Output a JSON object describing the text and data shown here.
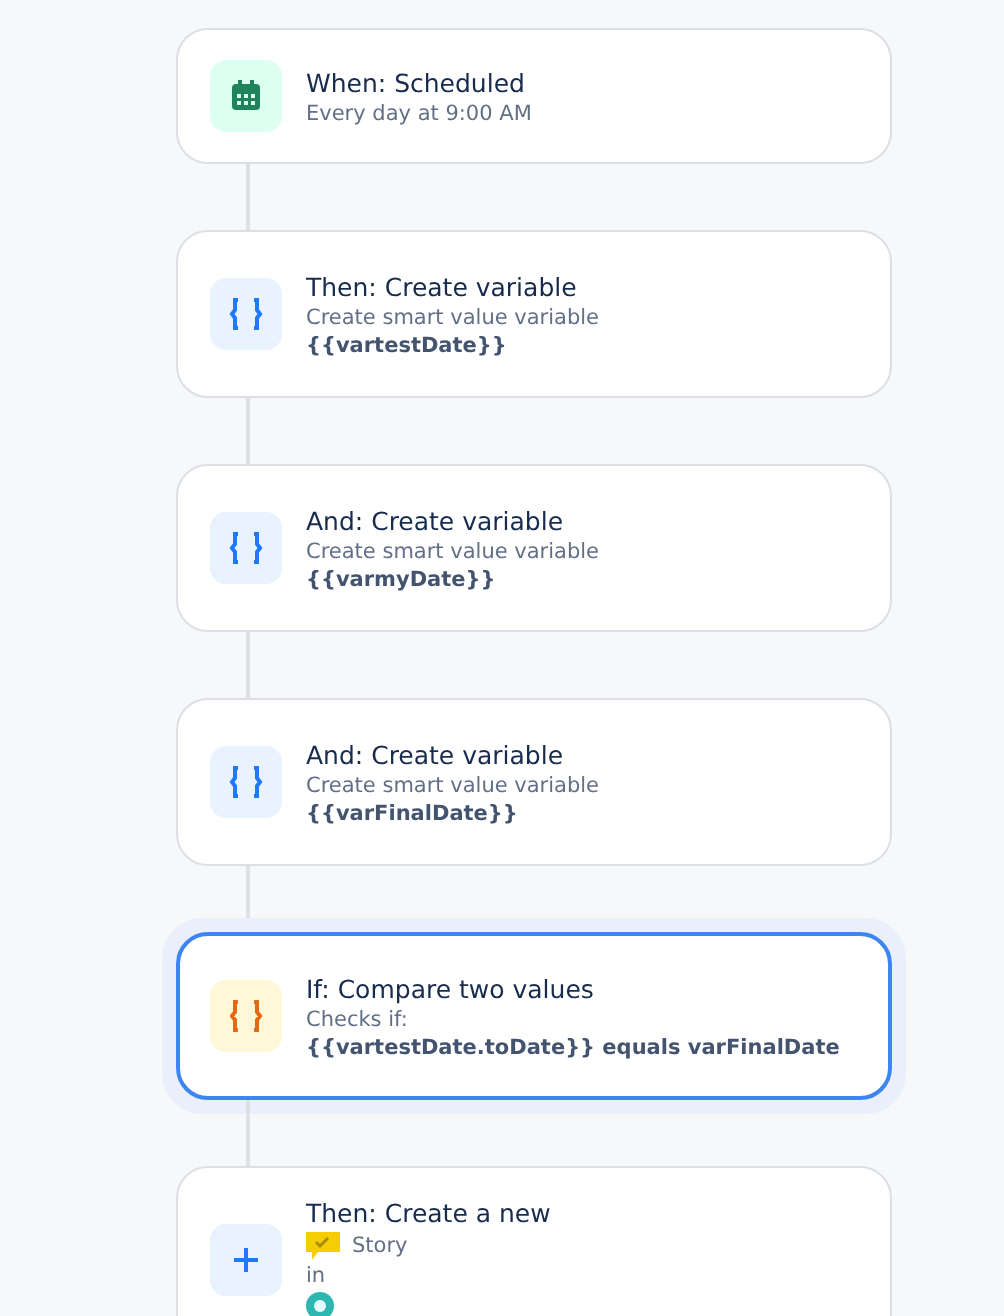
{
  "steps": [
    {
      "kind": "schedule",
      "title": "When: Scheduled",
      "selected": false,
      "lines": [
        {
          "kind": "plain",
          "text": "Every day at 9:00 AM"
        }
      ]
    },
    {
      "kind": "variable",
      "title": "Then: Create variable",
      "selected": false,
      "lines": [
        {
          "kind": "plain",
          "text": "Create smart value variable"
        },
        {
          "kind": "bold",
          "text": "{{vartestDate}}"
        }
      ]
    },
    {
      "kind": "variable",
      "title": "And: Create variable",
      "selected": false,
      "lines": [
        {
          "kind": "plain",
          "text": "Create smart value variable"
        },
        {
          "kind": "bold",
          "text": "{{varmyDate}}"
        }
      ]
    },
    {
      "kind": "variable",
      "title": "And: Create variable",
      "selected": false,
      "lines": [
        {
          "kind": "plain",
          "text": "Create smart value variable"
        },
        {
          "kind": "bold",
          "text": "{{varFinalDate}}"
        }
      ]
    },
    {
      "kind": "condition",
      "title": "If: Compare two values",
      "selected": true,
      "lines": [
        {
          "kind": "plain",
          "text": "Checks if:"
        },
        {
          "kind": "bold",
          "text": "{{vartestDate.toDate}} equals varFinalDate"
        }
      ]
    },
    {
      "kind": "create",
      "title": "Then: Create a new",
      "selected": false,
      "lines": [
        {
          "kind": "issue-type",
          "text": "Story"
        },
        {
          "kind": "plain",
          "text": "in"
        },
        {
          "kind": "project"
        }
      ]
    }
  ]
}
